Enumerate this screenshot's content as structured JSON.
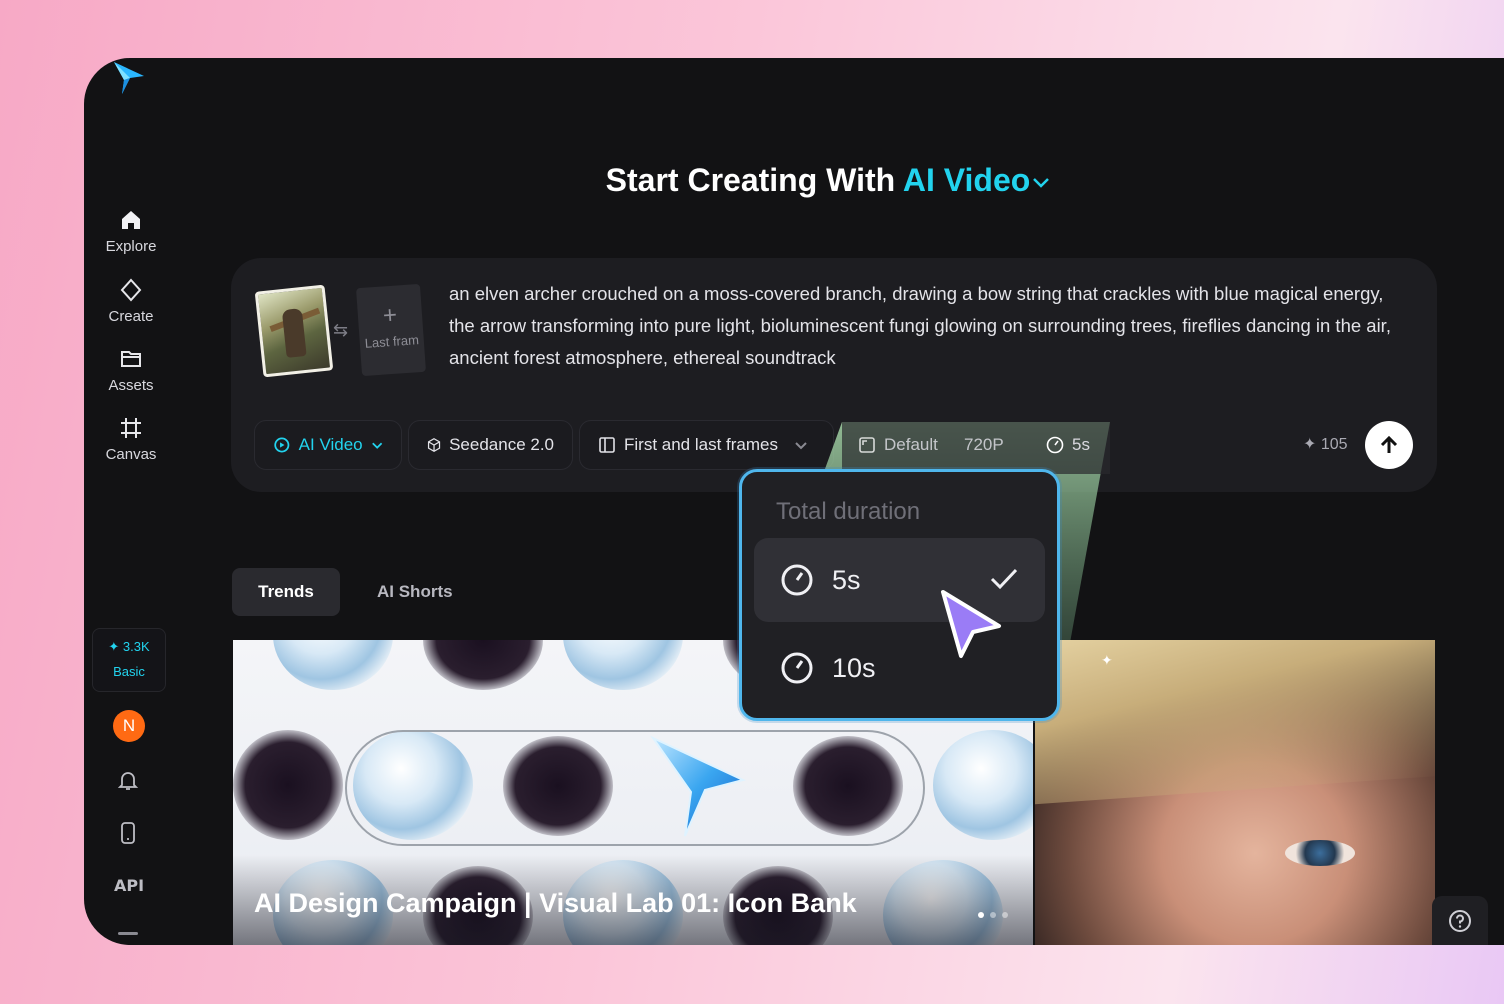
{
  "app": {
    "logo_icon": "star-logo-icon",
    "sidebar": {
      "items": [
        {
          "label": "Explore",
          "icon": "home-icon"
        },
        {
          "label": "Create",
          "icon": "diamond-icon"
        },
        {
          "label": "Assets",
          "icon": "folder-icon"
        },
        {
          "label": "Canvas",
          "icon": "crop-icon"
        }
      ],
      "credits": "3.3K",
      "plan": "Basic",
      "avatar_initial": "N",
      "api_label": "API"
    },
    "heading": {
      "prefix": "Start Creating With",
      "accent": "AI Video"
    },
    "prompt": {
      "text": "an elven archer crouched on a moss-covered branch, drawing a bow string that crackles with blue magical energy, the arrow transforming into pure light, bioluminescent fungi glowing on surrounding trees, fireflies dancing in the air, ancient forest atmosphere, ethereal soundtrack",
      "last_frame_label": "Last fram",
      "plus": "+"
    },
    "toolbar": {
      "mode": "AI Video",
      "model": "Seedance 2.0",
      "frames": "First and last frames",
      "ratio": "Default",
      "resolution": "720P",
      "duration": "5s",
      "cost": "105"
    },
    "duration_popup": {
      "title": "Total duration",
      "options": [
        {
          "label": "5s",
          "selected": true
        },
        {
          "label": "10s",
          "selected": false
        }
      ]
    },
    "tabs": [
      {
        "label": "Trends",
        "active": true
      },
      {
        "label": "AI Shorts",
        "active": false
      }
    ],
    "featured": {
      "caption": "AI Design Campaign | Visual Lab 01: Icon Bank"
    },
    "accent_color": "#22d3ee"
  }
}
